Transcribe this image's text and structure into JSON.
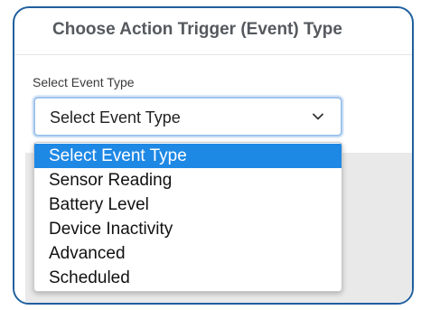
{
  "header": {
    "title": "Choose Action Trigger (Event) Type"
  },
  "event_type": {
    "label": "Select Event Type",
    "selected_value": "Select Event Type",
    "options": [
      {
        "label": "Select Event Type",
        "selected": true
      },
      {
        "label": "Sensor Reading",
        "selected": false
      },
      {
        "label": "Battery Level",
        "selected": false
      },
      {
        "label": "Device Inactivity",
        "selected": false
      },
      {
        "label": "Advanced",
        "selected": false
      },
      {
        "label": "Scheduled",
        "selected": false
      }
    ]
  },
  "icons": {
    "select_caret": "chevron-down-icon"
  },
  "colors": {
    "frame_border": "#1f5f9e",
    "highlight": "#1e88e5",
    "focus_ring": "#9fc3ec"
  }
}
